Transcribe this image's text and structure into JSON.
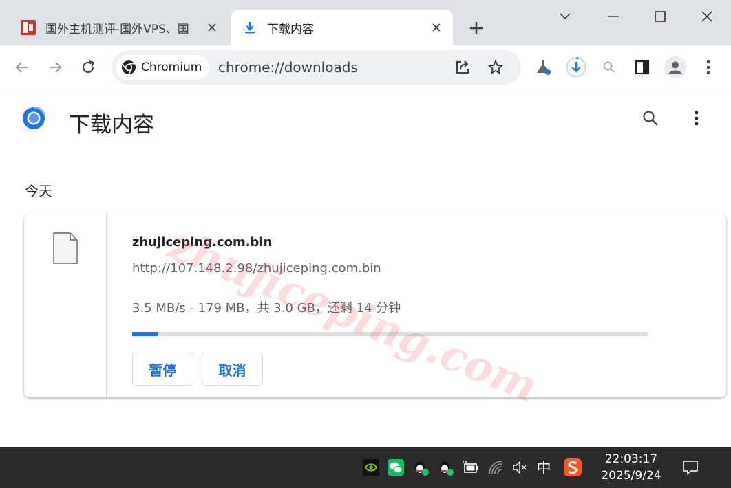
{
  "tabs": [
    {
      "title": "国外主机测评-国外VPS、国",
      "icon": "site-favicon",
      "active": false
    },
    {
      "title": "下载内容",
      "icon": "download-icon",
      "active": true
    }
  ],
  "toolbar": {
    "site_chip": "Chromium",
    "url": "chrome://downloads"
  },
  "page": {
    "title": "下载内容",
    "date_group": "今天"
  },
  "download": {
    "file_name": "zhujiceping.com.bin",
    "url": "http://107.148.2.98/zhujiceping.com.bin",
    "status": "3.5 MB/s - 179 MB，共 3.0 GB，还剩 14 分钟",
    "progress_fraction": 0.05,
    "pause_label": "暂停",
    "cancel_label": "取消"
  },
  "watermark": "zhujiceping.com",
  "taskbar": {
    "time": "22:03:17",
    "date": "2025/9/24",
    "ime": "中"
  },
  "colors": {
    "accent": "#1a73e8",
    "tabstrip": "#dfe3e8",
    "taskbar": "#2b2b2b"
  }
}
